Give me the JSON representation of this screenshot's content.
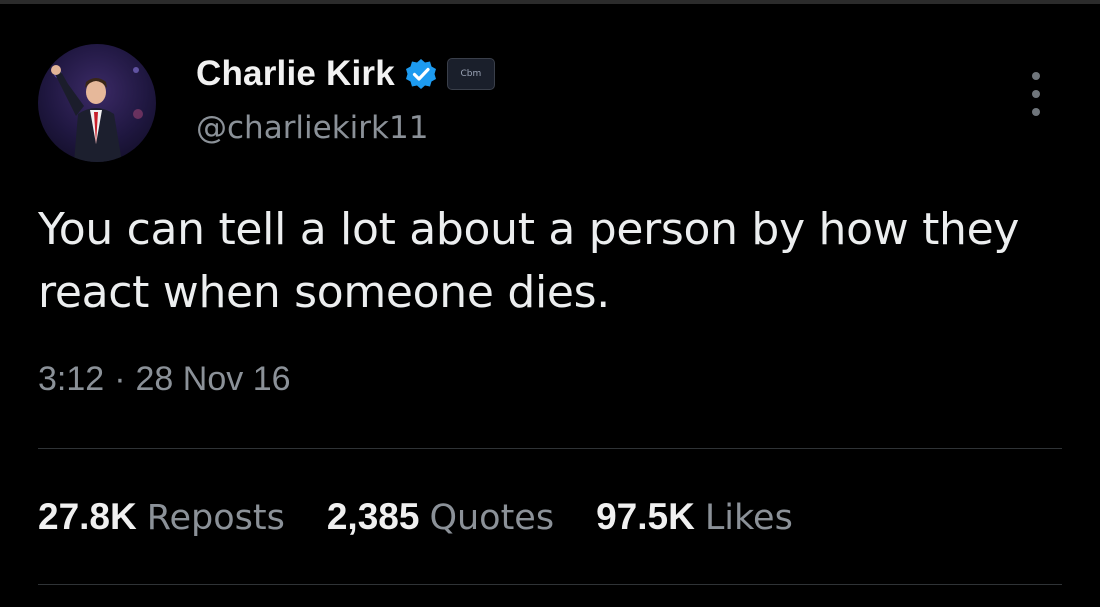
{
  "author": {
    "display_name": "Charlie Kirk",
    "handle": "@charliekirk11",
    "avatar_icon": "person-portrait-avatar",
    "verified_icon": "verified-checkmark-icon",
    "affiliate_badge_icon": "affiliate-logo-badge",
    "affiliate_badge_text": "Cbm"
  },
  "tweet": {
    "text": "You can tell a lot about a person by how they react when someone dies.",
    "time": "3:12",
    "separator": "·",
    "date": "28 Nov 16"
  },
  "stats": {
    "reposts_count": "27.8K",
    "reposts_label": "Reposts",
    "quotes_count": "2,385",
    "quotes_label": "Quotes",
    "likes_count": "97.5K",
    "likes_label": "Likes"
  },
  "colors": {
    "background": "#000000",
    "primary_text": "#e7e9ea",
    "secondary_text": "#8b9198",
    "verified_blue": "#1d9bf0",
    "divider": "#2f3336"
  }
}
